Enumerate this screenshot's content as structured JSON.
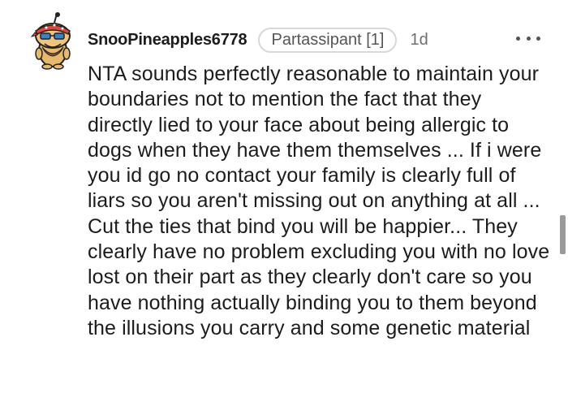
{
  "comment": {
    "author": "SnooPineapples6778",
    "flair": "Partassipant [1]",
    "age": "1d",
    "body": "NTA sounds perfectly reasonable to maintain your boundaries not to mention the fact that they directly lied to your face about being allergic to dogs when they have them themselves ... If i were you id go no contact your family is clearly full of liars so you aren't missing out on anything at all ... Cut the ties that bind you will be happier... They clearly have no problem excluding you with no love lost on their part as they clearly don't care so you have nothing actually binding you to them beyond the illusions you carry and some genetic material"
  },
  "icons": {
    "avatar": "snoo-avatar-icon",
    "more": "more-options-icon"
  },
  "colors": {
    "avatar_skin": "#e8b96a",
    "avatar_bandana": "#e2463a",
    "flair_border": "#d8d8d8",
    "scrollbar": "#9a9a9a"
  }
}
